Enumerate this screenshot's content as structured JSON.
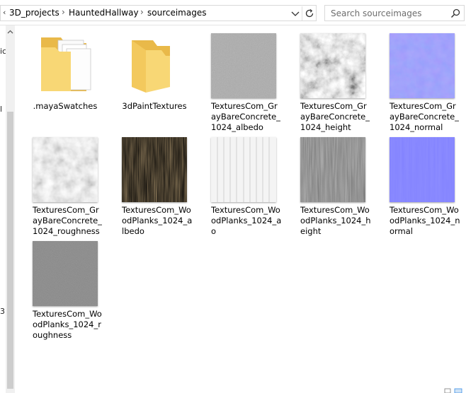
{
  "breadcrumb": {
    "items": [
      "3D_projects",
      "HauntedHallway",
      "sourceimages"
    ]
  },
  "search": {
    "placeholder": "Search sourceimages"
  },
  "nav_fragments": [
    "ic",
    "l",
    "3)"
  ],
  "files": [
    {
      "label": ".mayaSwatches",
      "kind": "folder-docs",
      "icon": "folder-with-documents-icon"
    },
    {
      "label": "3dPaintTextures",
      "kind": "folder",
      "icon": "folder-icon"
    },
    {
      "label": "TexturesCom_GrayBareConcrete_1024_albedo",
      "kind": "image",
      "texture": "concrete-albedo"
    },
    {
      "label": "TexturesCom_GrayBareConcrete_1024_height",
      "kind": "image",
      "texture": "concrete-height"
    },
    {
      "label": "TexturesCom_GrayBareConcrete_1024_normal",
      "kind": "image",
      "texture": "concrete-normal"
    },
    {
      "label": "TexturesCom_GrayBareConcrete_1024_roughness",
      "kind": "image",
      "texture": "concrete-roughness"
    },
    {
      "label": "TexturesCom_WoodPlanks_1024_albedo",
      "kind": "image",
      "texture": "wood-albedo"
    },
    {
      "label": "TexturesCom_WoodPlanks_1024_ao",
      "kind": "image",
      "texture": "wood-ao"
    },
    {
      "label": "TexturesCom_WoodPlanks_1024_height",
      "kind": "image",
      "texture": "wood-height"
    },
    {
      "label": "TexturesCom_WoodPlanks_1024_normal",
      "kind": "image",
      "texture": "wood-normal"
    },
    {
      "label": "TexturesCom_WoodPlanks_1024_roughness",
      "kind": "image",
      "texture": "wood-roughness"
    }
  ],
  "colors": {
    "folder_yellow": "#f8d775",
    "folder_dark": "#e9b949",
    "normal_blue": "#8080ff",
    "wood_brown": "#9b8663"
  }
}
